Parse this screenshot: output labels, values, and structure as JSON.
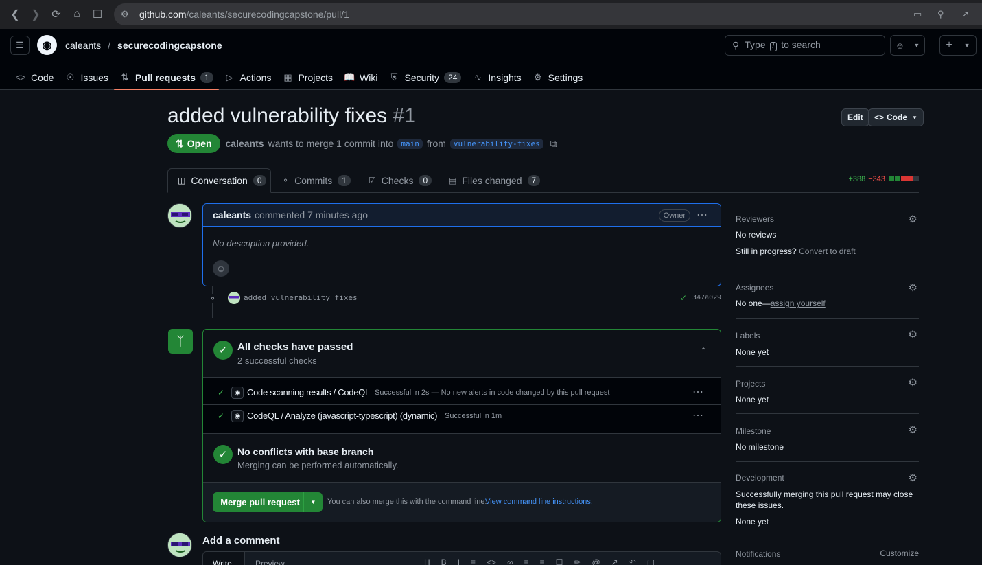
{
  "browser": {
    "url_host": "github.com",
    "url_path": "/caleants/securecodingcapstone/pull/1"
  },
  "header": {
    "owner": "caleants",
    "separator": "/",
    "repo": "securecodingcapstone",
    "search_pre": "Type",
    "search_key": "/",
    "search_post": "to search"
  },
  "reponav": {
    "items": [
      {
        "label": "Code",
        "icon": "code-icon"
      },
      {
        "label": "Issues",
        "icon": "issue-icon"
      },
      {
        "label": "Pull requests",
        "icon": "pr-icon",
        "count": "1"
      },
      {
        "label": "Actions",
        "icon": "play-icon"
      },
      {
        "label": "Projects",
        "icon": "table-icon"
      },
      {
        "label": "Wiki",
        "icon": "book-icon"
      },
      {
        "label": "Security",
        "icon": "shield-icon",
        "count": "24"
      },
      {
        "label": "Insights",
        "icon": "graph-icon"
      },
      {
        "label": "Settings",
        "icon": "gear-icon"
      }
    ]
  },
  "pr": {
    "title": "added vulnerability fixes",
    "number": "#1",
    "edit_label": "Edit",
    "code_label": "Code",
    "status": "Open",
    "author": "caleants",
    "merge_text": "wants to merge 1 commit into",
    "base_branch": "main",
    "from_text": "from",
    "head_branch": "vulnerability-fixes"
  },
  "tabs": [
    {
      "label": "Conversation",
      "count": "0"
    },
    {
      "label": "Commits",
      "count": "1"
    },
    {
      "label": "Checks",
      "count": "0"
    },
    {
      "label": "Files changed",
      "count": "7"
    }
  ],
  "diffstat": {
    "additions": "+388",
    "deletions": "−343",
    "squares": [
      "#238636",
      "#238636",
      "#da3633",
      "#da3633",
      "#30363d"
    ]
  },
  "comment": {
    "author": "caleants",
    "meta": "commented 7 minutes ago",
    "badge": "Owner",
    "body": "No description provided."
  },
  "commit": {
    "message": "added vulnerability fixes",
    "sha": "347a029"
  },
  "merge": {
    "checks_title": "All checks have passed",
    "checks_sub": "2 successful checks",
    "checks": [
      {
        "name": "Code scanning results / CodeQL",
        "detail": "Successful in 2s — No new alerts in code changed by this pull request"
      },
      {
        "name": "CodeQL / Analyze (javascript-typescript) (dynamic)",
        "detail": "Successful in 1m"
      }
    ],
    "conflict_title": "No conflicts with base branch",
    "conflict_sub": "Merging can be performed automatically.",
    "merge_button": "Merge pull request",
    "cli_text": "You can also merge this with the command line.",
    "cli_link": "View command line instructions."
  },
  "add_comment": {
    "title": "Add a comment",
    "write_tab": "Write",
    "preview_tab": "Preview"
  },
  "sidebar": {
    "reviewers_label": "Reviewers",
    "reviewers_value": "No reviews",
    "progress_text": "Still in progress?",
    "progress_link": "Convert to draft",
    "assignees_label": "Assignees",
    "assignees_value": "No one—",
    "assignees_link": "assign yourself",
    "labels_label": "Labels",
    "labels_value": "None yet",
    "projects_label": "Projects",
    "projects_value": "None yet",
    "milestone_label": "Milestone",
    "milestone_value": "No milestone",
    "development_label": "Development",
    "development_text": "Successfully merging this pull request may close these issues.",
    "development_value": "None yet",
    "notifications_label": "Notifications",
    "notifications_action": "Customize"
  }
}
